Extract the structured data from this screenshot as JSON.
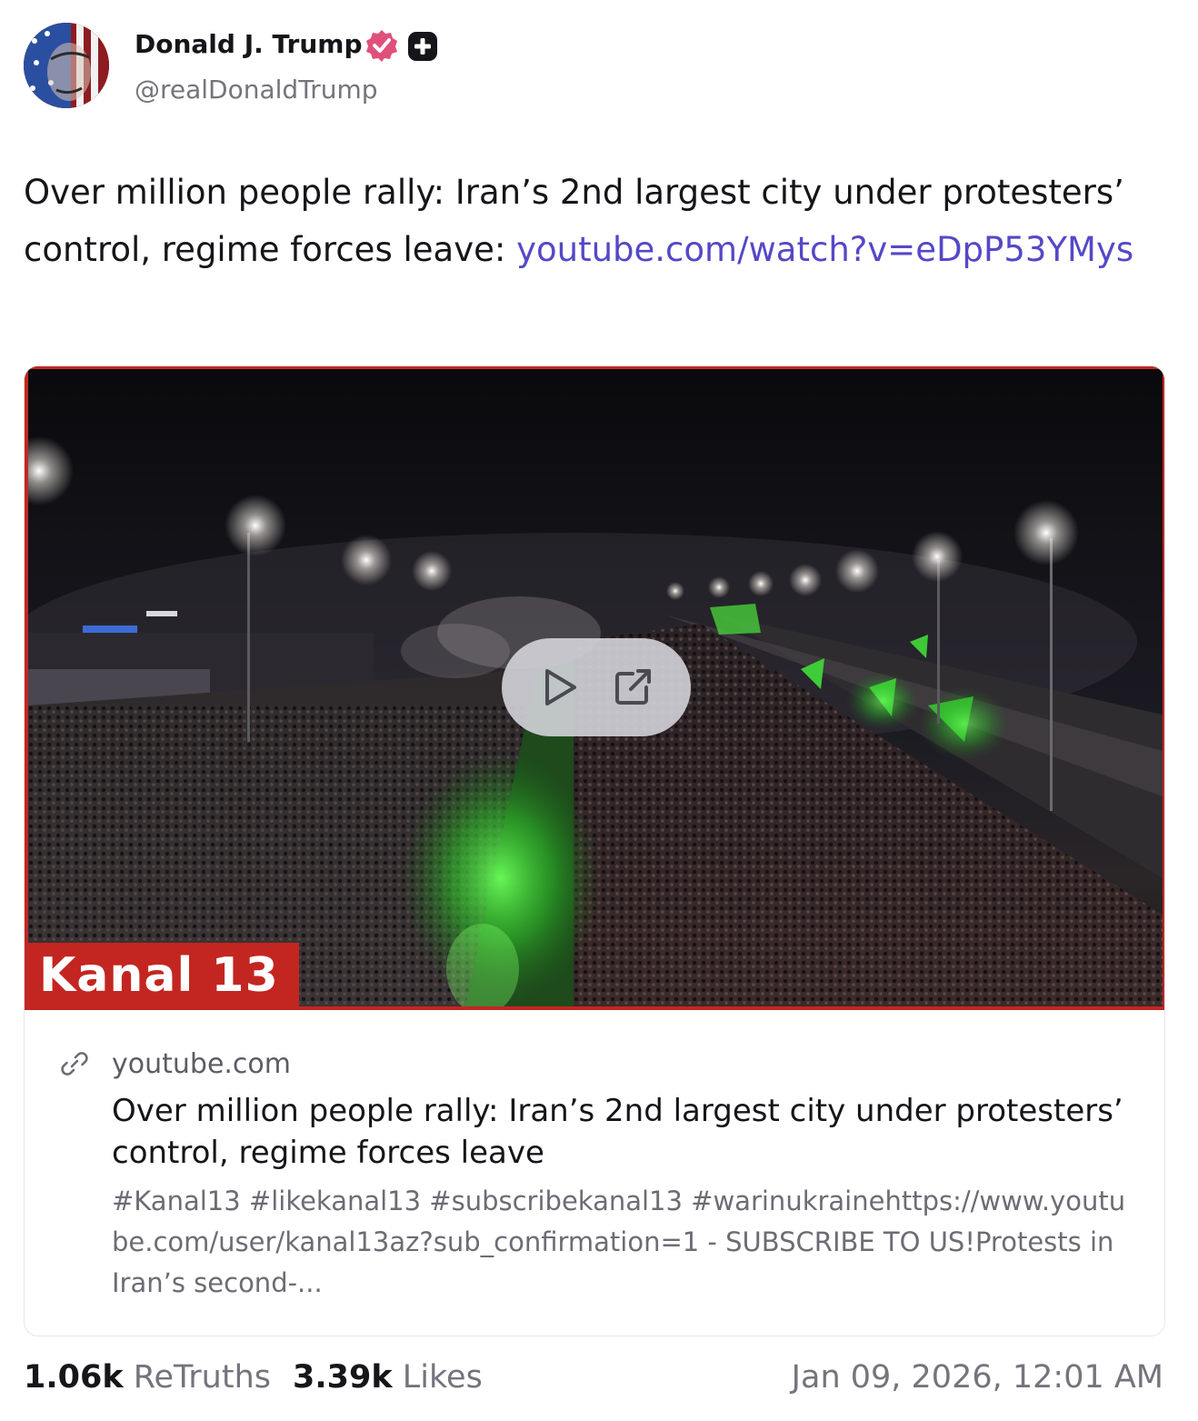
{
  "author": {
    "name": "Donald J. Trump",
    "handle": "@realDonaldTrump",
    "verified_icon": "verified-badge-icon",
    "plus_icon": "plus-badge-icon"
  },
  "post": {
    "text": "Over million people rally: Iran’s 2nd largest city under protesters’ control, regime forces leave: ",
    "link_text": "youtube.com/watch?v=eDpP53YMys"
  },
  "card": {
    "video_overlay_label": "Kanal 13",
    "play_icon": "play-icon",
    "open_external_icon": "external-link-icon",
    "link_icon": "link-icon",
    "domain": "youtube.com",
    "title": "Over million people rally: Iran’s 2nd largest city under protesters’ control, regime forces leave",
    "description": "#Kanal13 #likekanal13 #subscribekanal13 #warinukrainehttps://www.youtube.com/user/kanal13az?sub_confirmation=1 - SUBSCRIBE TO US!Protests in Iran’s second-..."
  },
  "stats": {
    "retruths_count": "1.06k",
    "retruths_label": "ReTruths",
    "likes_count": "3.39k",
    "likes_label": "Likes"
  },
  "timestamp": "Jan 09, 2026, 12:01 AM",
  "colors": {
    "link": "#5448c8",
    "kanal_red": "#c32621",
    "verified_pink": "#e0507b",
    "muted_text": "#74747d"
  }
}
